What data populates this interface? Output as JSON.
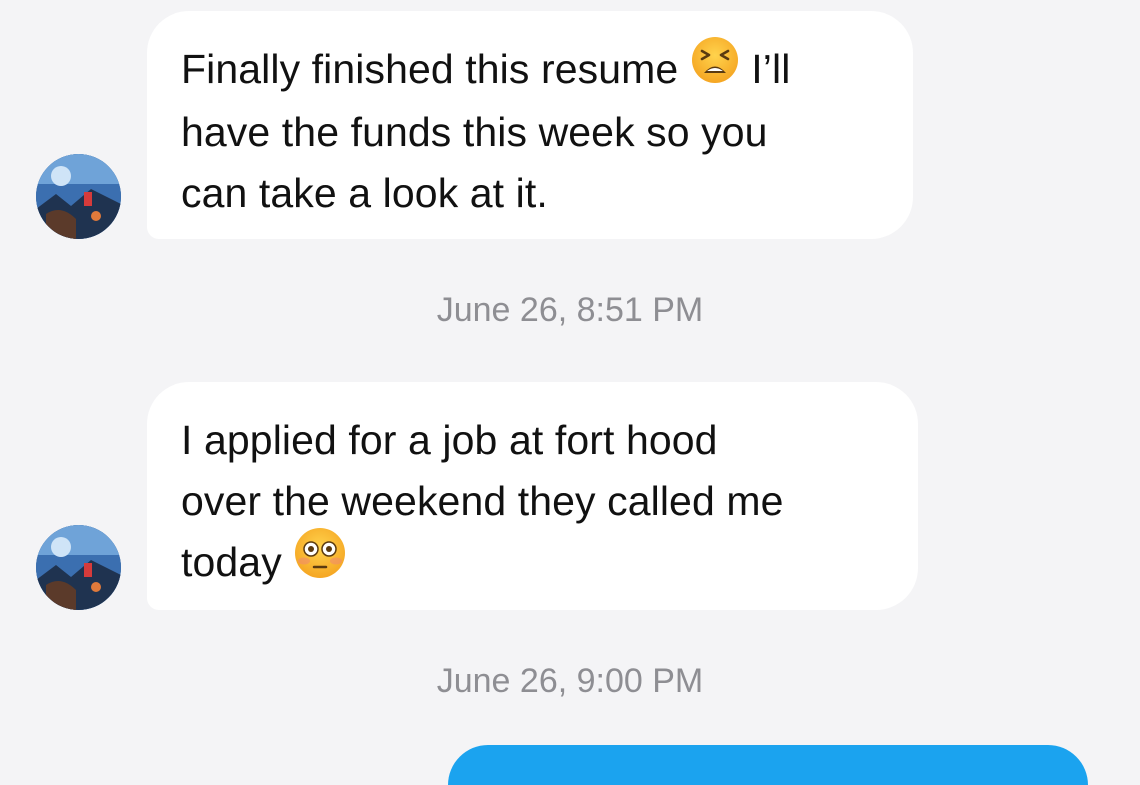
{
  "messages": [
    {
      "lines": [
        "Finally finished this resume",
        "I’ll",
        "have the funds this week so you",
        "can take a look at it."
      ],
      "emoji": "tired-face-emoji"
    },
    {
      "lines": [
        "I applied for a job at fort hood",
        "over the weekend they called me",
        "today"
      ],
      "emoji": "flushed-face-emoji"
    }
  ],
  "timestamps": [
    "June 26, 8:51 PM",
    "June 26, 9:00 PM"
  ],
  "colors": {
    "background": "#f4f4f6",
    "received_bubble": "#ffffff",
    "sent_bubble": "#1ba3ef",
    "timestamp_text": "#8e8e93"
  }
}
